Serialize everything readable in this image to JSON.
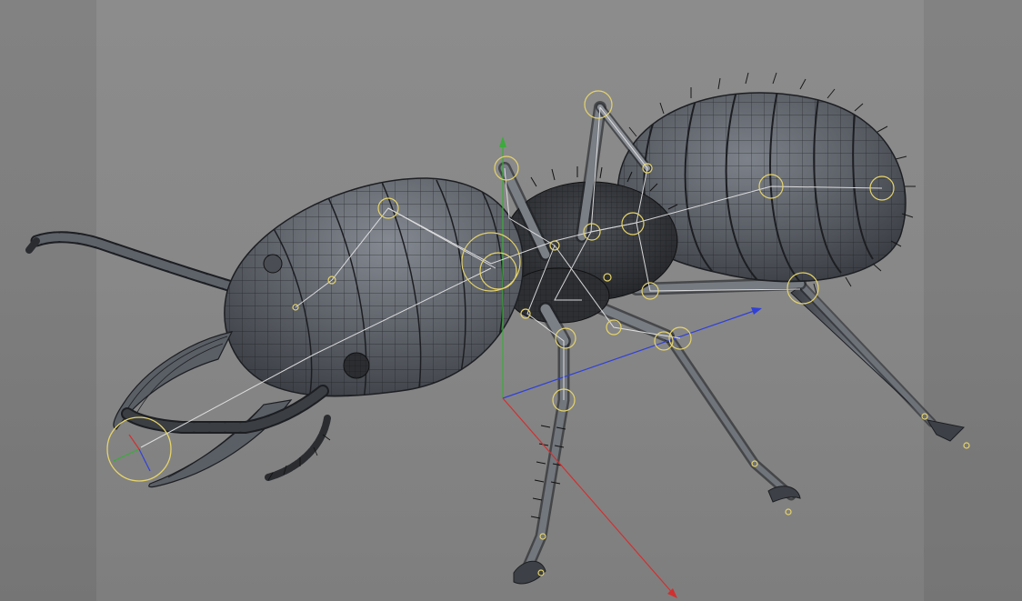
{
  "viewport": {
    "background_color": "#8a8a8a",
    "mesh_fill_color": "#5b5f66",
    "wire_color": "#1c1e22",
    "joint_color": "#e6d36a",
    "bone_color": "#e8e8e8",
    "axis_colors": {
      "x": "#d03030",
      "y": "#3caa3c",
      "z": "#3040d8"
    }
  },
  "scene": {
    "object": "termite-model",
    "icons": [
      "world-axis-icon",
      "joint-icon",
      "bone-icon",
      "selected-joint-axis-icon"
    ]
  }
}
